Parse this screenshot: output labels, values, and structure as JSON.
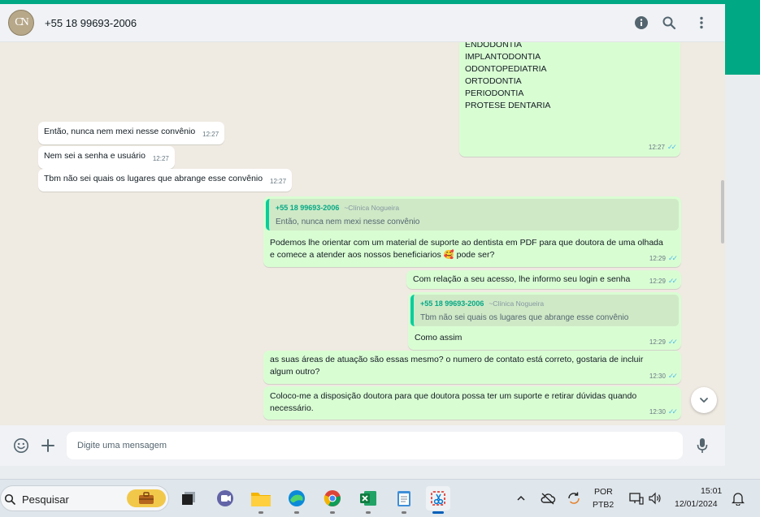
{
  "header": {
    "contact": "+55 18 99693-2006",
    "avatar_text": "CN"
  },
  "specialties": {
    "partial_line": "ENDODONTIA",
    "items": [
      "IMPLANTODONTIA",
      "ODONTOPEDIATRIA",
      "ORTODONTIA",
      "PERIODONTIA",
      "PROTESE DENTARIA"
    ],
    "time": "12:27"
  },
  "incoming": [
    {
      "text": "Então, nunca nem mexi nesse convênio",
      "time": "12:27"
    },
    {
      "text": "Nem sei a senha e usuário",
      "time": "12:27"
    },
    {
      "text": "Tbm não sei quais os lugares que abrange esse convênio",
      "time": "12:27"
    }
  ],
  "reply1": {
    "quote_author": "+55 18 99693-2006",
    "quote_sub": "~Clínica Nogueira",
    "quote_text": "Então, nunca nem mexi nesse convênio",
    "text": "Podemos lhe orientar com um material de suporte ao dentista em PDF para que doutora de uma olhada e comece a atender aos nossos beneficiarios 🥰 pode ser?",
    "time": "12:29"
  },
  "msg_access": {
    "text": "Com relação a seu acesso, lhe informo seu login e senha",
    "time": "12:29"
  },
  "reply2": {
    "quote_author": "+55 18 99693-2006",
    "quote_sub": "~Clínica Nogueira",
    "quote_text": "Tbm não sei quais os lugares que abrange esse convênio",
    "text": "Como assim",
    "time": "12:29"
  },
  "msg_areas": {
    "text": "as suas áreas de atuação são essas mesmo? o numero de contato está correto, gostaria de incluir algum outro?",
    "time": "12:30"
  },
  "msg_support": {
    "text": "Coloco-me a disposição doutora para que doutora possa ter um suporte e retirar dúvidas quando necessário.",
    "time": "12:30"
  },
  "composer": {
    "placeholder": "Digite uma mensagem"
  },
  "taskbar": {
    "search_label": "Pesquisar",
    "lang_top": "POR",
    "lang_bottom": "PTB2",
    "clock_time": "15:01",
    "clock_date": "12/01/2024"
  },
  "colors": {
    "accent": "#00a884",
    "outgoing_bubble": "#d9fdd3",
    "incoming_bubble": "#ffffff",
    "chat_bg": "#efeae2",
    "read_ticks": "#53bdeb"
  }
}
